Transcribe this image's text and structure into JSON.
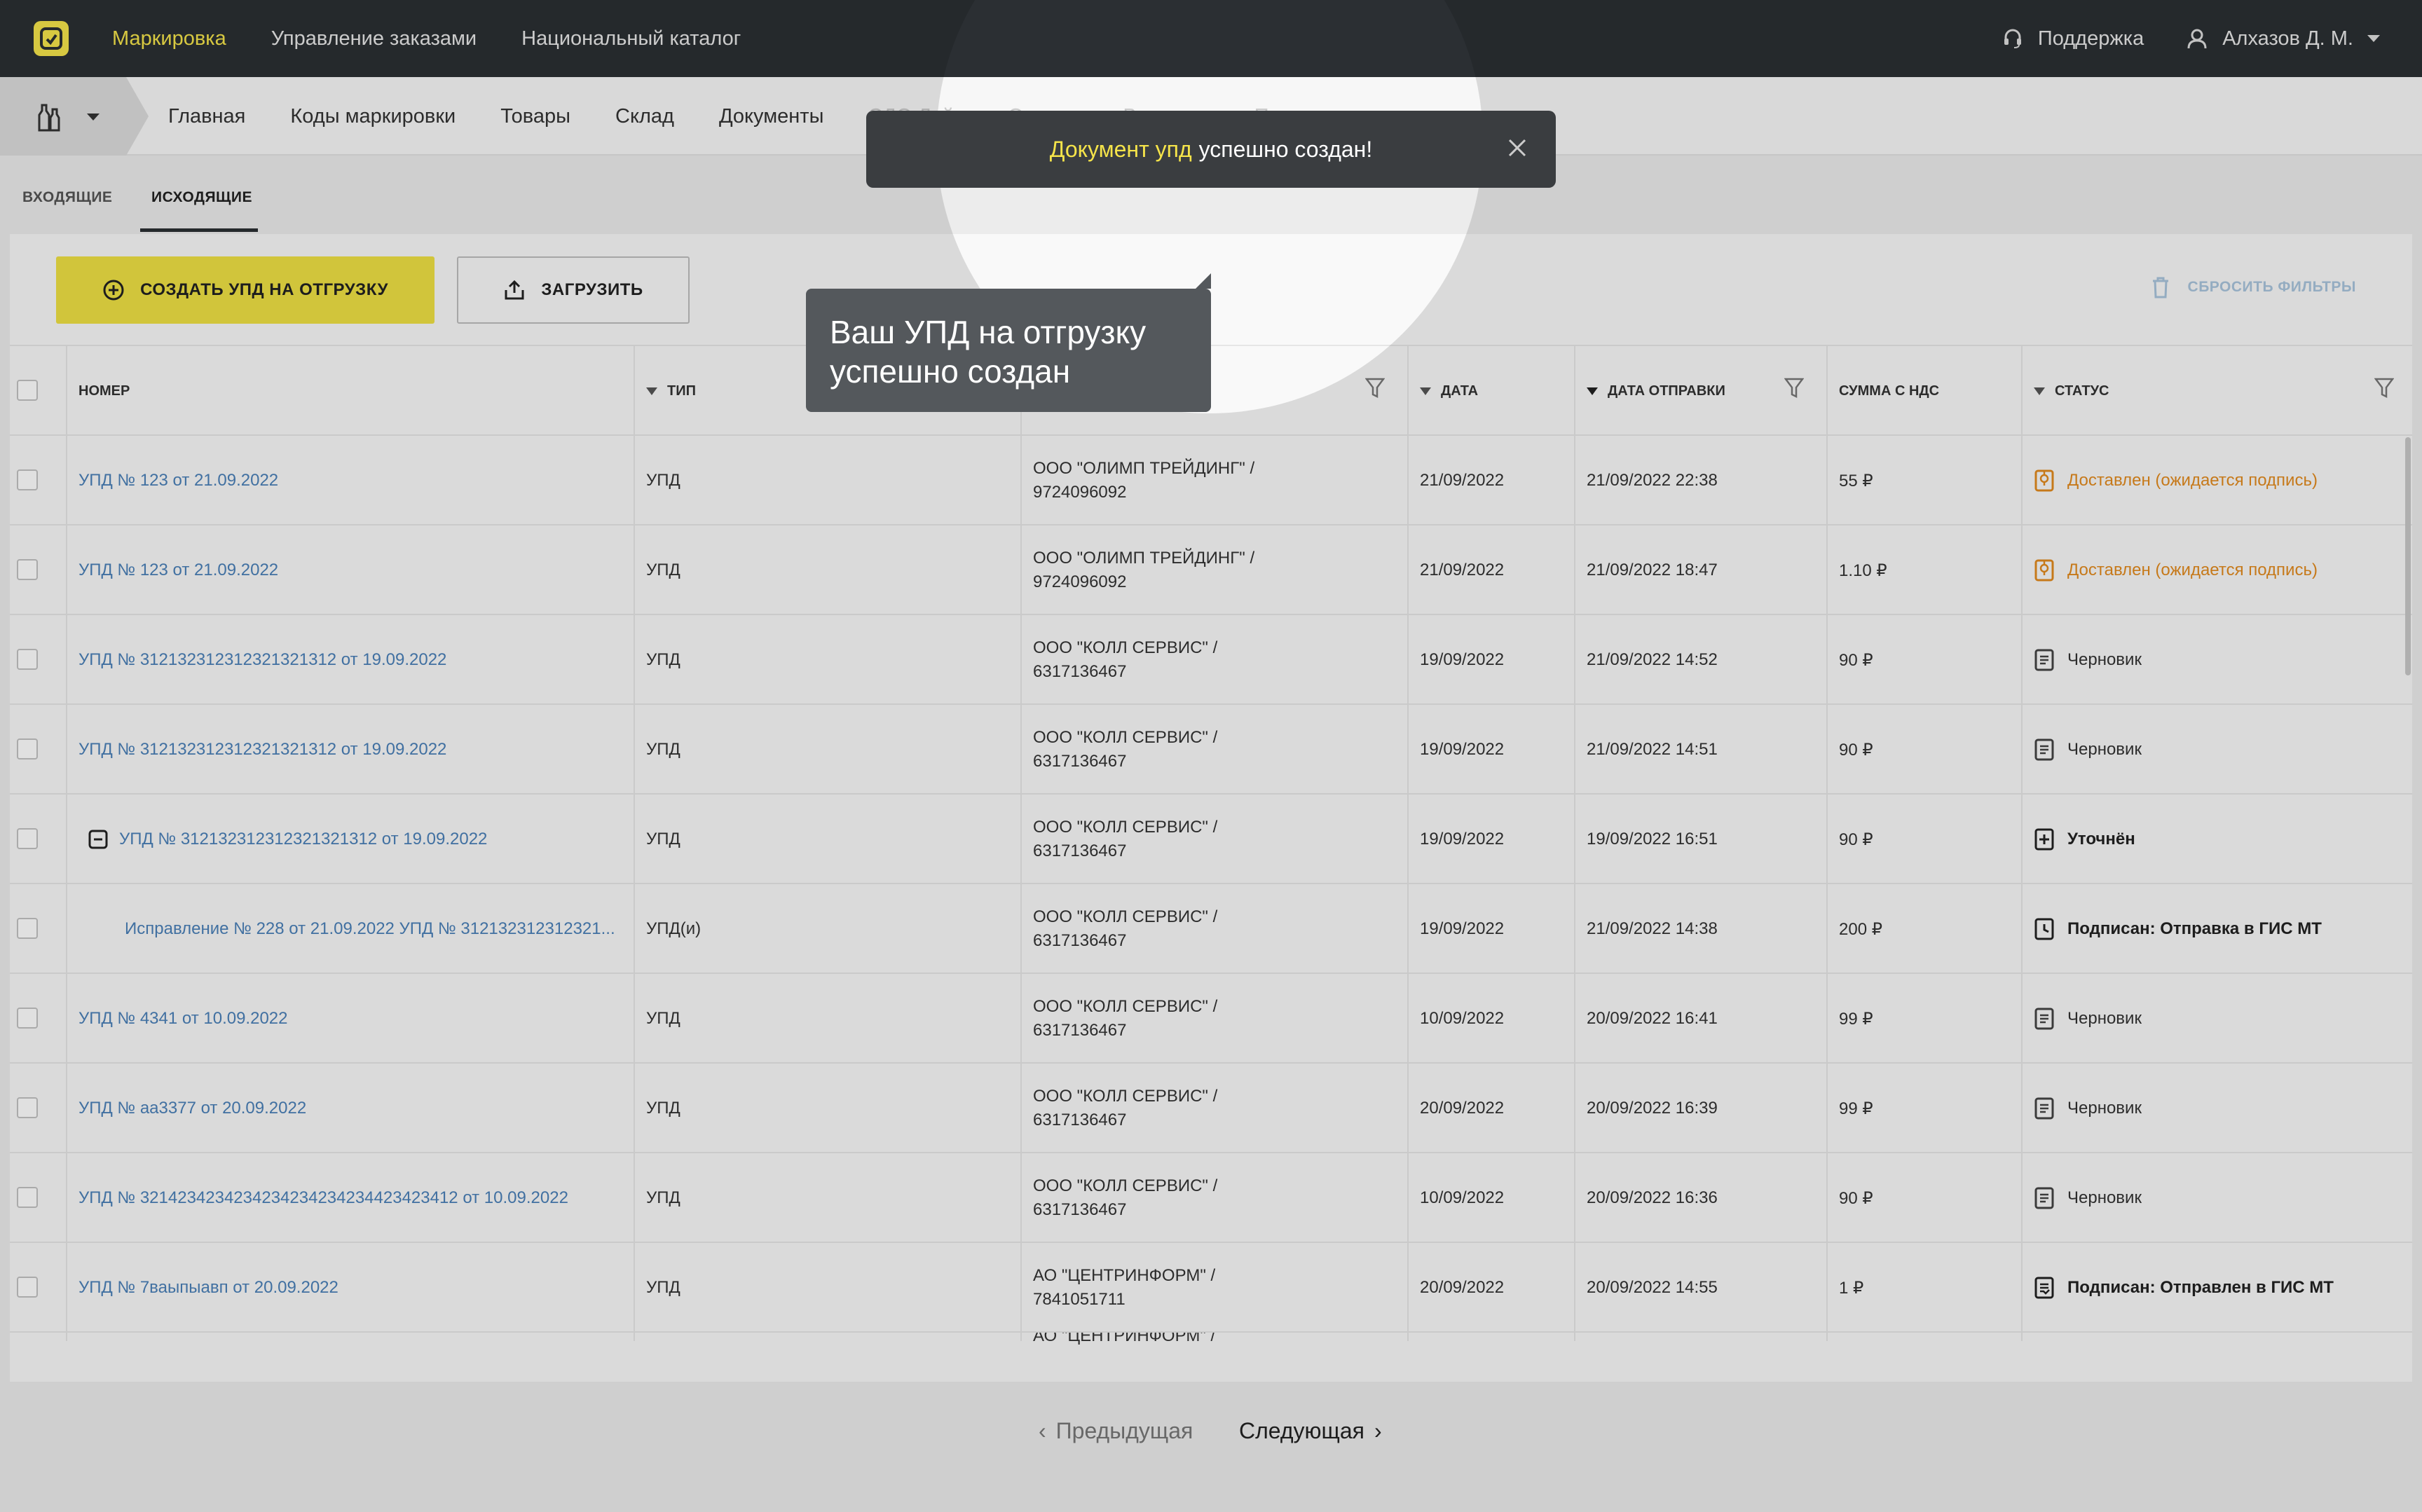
{
  "topbar": {
    "nav": [
      "Маркировка",
      "Управление заказами",
      "Национальный каталог"
    ],
    "support": "Поддержка",
    "user": "Алхазов Д. М."
  },
  "subnav": {
    "items": [
      "Главная",
      "Коды маркировки",
      "Товары",
      "Склад",
      "Документы"
    ],
    "faded_items": [
      "ЭДО Лайт",
      "Отчеты",
      "Выгрузки",
      "Помощь"
    ]
  },
  "tabs": [
    "ВХОДЯЩИЕ",
    "ИСХОДЯЩИЕ"
  ],
  "actions": {
    "create": "СОЗДАТЬ УПД НА ОТГРУЗКУ",
    "upload": "ЗАГРУЗИТЬ",
    "reset": "СБРОСИТЬ ФИЛЬТРЫ"
  },
  "columns": {
    "number": "НОМЕР",
    "type": "ТИП",
    "date": "ДАТА",
    "sent": "ДАТА ОТПРАВКИ",
    "sum": "СУММА С НДС",
    "status": "СТАТУС"
  },
  "rows": [
    {
      "number": "УПД № 123 от 21.09.2022",
      "type": "УПД",
      "cp1": "ООО \"ОЛИМП ТРЕЙДИНГ\" /",
      "cp2": "9724096092",
      "date": "21/09/2022",
      "sent": "21/09/2022 22:38",
      "sum": "55 ₽",
      "status": "Доставлен (ожидается подпись)"
    },
    {
      "number": "УПД № 123 от 21.09.2022",
      "type": "УПД",
      "cp1": "ООО \"ОЛИМП ТРЕЙДИНГ\" /",
      "cp2": "9724096092",
      "date": "21/09/2022",
      "sent": "21/09/2022 18:47",
      "sum": "1.10 ₽",
      "status": "Доставлен (ожидается подпись)"
    },
    {
      "number": "УПД № 312132312312321321312 от 19.09.2022",
      "type": "УПД",
      "cp1": "ООО \"КОЛЛ СЕРВИС\" /",
      "cp2": "6317136467",
      "date": "19/09/2022",
      "sent": "21/09/2022 14:52",
      "sum": "90 ₽",
      "status": "Черновик"
    },
    {
      "number": "УПД № 312132312312321321312 от 19.09.2022",
      "type": "УПД",
      "cp1": "ООО \"КОЛЛ СЕРВИС\" /",
      "cp2": "6317136467",
      "date": "19/09/2022",
      "sent": "21/09/2022 14:51",
      "sum": "90 ₽",
      "status": "Черновик"
    },
    {
      "number": "УПД № 312132312312321321312 от 19.09.2022",
      "type": "УПД",
      "cp1": "ООО \"КОЛЛ СЕРВИС\" /",
      "cp2": "6317136467",
      "date": "19/09/2022",
      "sent": "19/09/2022 16:51",
      "sum": "90 ₽",
      "status": "Уточнён"
    },
    {
      "number": "Исправление № 228 от 21.09.2022 УПД № 312132312312321...",
      "type": "УПД(и)",
      "cp1": "ООО \"КОЛЛ СЕРВИС\" /",
      "cp2": "6317136467",
      "date": "19/09/2022",
      "sent": "21/09/2022 14:38",
      "sum": "200 ₽",
      "status": "Подписан: Отправка в ГИС МТ"
    },
    {
      "number": "УПД № 4341 от 10.09.2022",
      "type": "УПД",
      "cp1": "ООО \"КОЛЛ СЕРВИС\" /",
      "cp2": "6317136467",
      "date": "10/09/2022",
      "sent": "20/09/2022 16:41",
      "sum": "99 ₽",
      "status": "Черновик"
    },
    {
      "number": "УПД № аа3377 от 20.09.2022",
      "type": "УПД",
      "cp1": "ООО \"КОЛЛ СЕРВИС\" /",
      "cp2": "6317136467",
      "date": "20/09/2022",
      "sent": "20/09/2022 16:39",
      "sum": "99 ₽",
      "status": "Черновик"
    },
    {
      "number": "УПД № 3214234234234234234234234423423412 от 10.09.2022",
      "type": "УПД",
      "cp1": "ООО \"КОЛЛ СЕРВИС\" /",
      "cp2": "6317136467",
      "date": "10/09/2022",
      "sent": "20/09/2022 16:36",
      "sum": "90 ₽",
      "status": "Черновик"
    },
    {
      "number": "УПД № 7ваыпыавп от 20.09.2022",
      "type": "УПД",
      "cp1": "АО \"ЦЕНТРИНФОРМ\" /",
      "cp2": "7841051711",
      "date": "20/09/2022",
      "sent": "20/09/2022 14:55",
      "sum": "1 ₽",
      "status": "Подписан: Отправлен в ГИС МТ"
    }
  ],
  "partial_row": {
    "cp1": "АО \"ЦЕНТРИНФОРМ\" /"
  },
  "pagination": {
    "prev": "Предыдущая",
    "next": "Следующая"
  },
  "toast": {
    "highlight": "Документ упд",
    "text": "успешно создан!"
  },
  "tooltip": {
    "line1": "Ваш УПД на отгрузку",
    "line2": "успешно создан"
  },
  "colors": {
    "accent": "#f5e44a",
    "link": "#4a80b8",
    "status_warning": "#e28a1e",
    "topbar": "#2b2f33"
  }
}
